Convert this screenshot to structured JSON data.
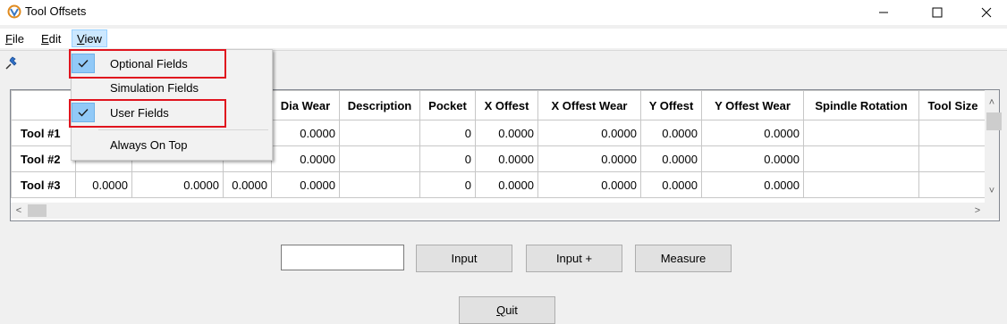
{
  "window": {
    "title": "Tool Offsets",
    "minimize": "—",
    "maximize": "☐",
    "close": "✕"
  },
  "menubar": {
    "file": {
      "hotkey": "F",
      "rest": "ile"
    },
    "edit": {
      "hotkey": "E",
      "rest": "dit"
    },
    "view": {
      "hotkey": "V",
      "rest": "iew"
    }
  },
  "view_menu": {
    "items": [
      {
        "label": "Optional Fields",
        "checked": true
      },
      {
        "label": "Simulation Fields",
        "checked": false
      },
      {
        "label": "User Fields",
        "checked": true
      },
      {
        "label": "Always On Top",
        "checked": false
      }
    ]
  },
  "grid": {
    "columns": [
      "",
      "",
      "",
      "",
      "Dia Wear",
      "Description",
      "Pocket",
      "X Offest",
      "X Offest Wear",
      "Y Offest",
      "Y Offest Wear",
      "Spindle Rotation",
      "Tool Size"
    ],
    "rows": [
      {
        "name": "Tool #1",
        "c1": "",
        "c2": "",
        "c3": "",
        "dia_wear": "0.0000",
        "description": "",
        "pocket": "0",
        "x_offest": "0.0000",
        "x_offest_wear": "0.0000",
        "y_offest": "0.0000",
        "y_offest_wear": "0.0000",
        "spindle_rotation": "",
        "tool_size": ""
      },
      {
        "name": "Tool #2",
        "c1": "",
        "c2": "",
        "c3": "",
        "dia_wear": "0.0000",
        "description": "",
        "pocket": "0",
        "x_offest": "0.0000",
        "x_offest_wear": "0.0000",
        "y_offest": "0.0000",
        "y_offest_wear": "0.0000",
        "spindle_rotation": "",
        "tool_size": ""
      },
      {
        "name": "Tool #3",
        "c1": "0.0000",
        "c2": "0.0000",
        "c3": "0.0000",
        "dia_wear": "0.0000",
        "description": "",
        "pocket": "0",
        "x_offest": "0.0000",
        "x_offest_wear": "0.0000",
        "y_offest": "0.0000",
        "y_offest_wear": "0.0000",
        "spindle_rotation": "",
        "tool_size": ""
      }
    ]
  },
  "controls": {
    "value_input": "",
    "input_label": "Input",
    "input_plus_label": "Input +",
    "measure_label": "Measure",
    "quit": {
      "hotkey": "Q",
      "rest": "uit"
    }
  },
  "icons": {
    "app": "app-logo-icon",
    "pin": "pin-icon",
    "check": "checkmark-icon"
  },
  "colors": {
    "menu_highlight": "#cce8ff",
    "check_bg": "#91c9f7",
    "annotation_red": "#e0141e"
  }
}
